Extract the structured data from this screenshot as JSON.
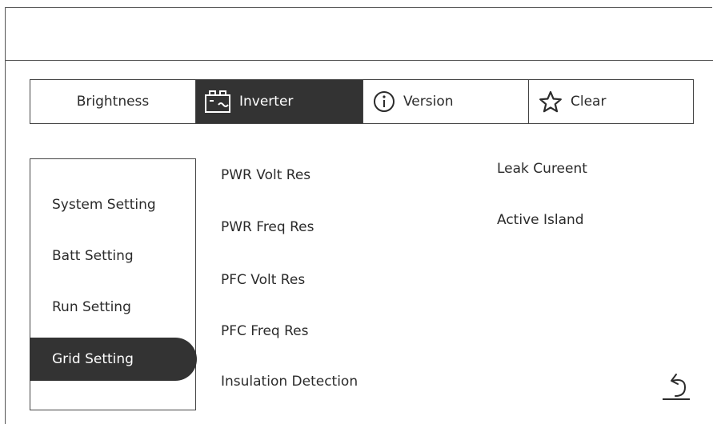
{
  "tabs": {
    "brightness": "Brightness",
    "inverter": "Inverter",
    "version": "Version",
    "clear": "Clear"
  },
  "sidebar": {
    "items": [
      {
        "label": "System Setting"
      },
      {
        "label": "Batt Setting"
      },
      {
        "label": "Run Setting"
      },
      {
        "label": "Grid Setting",
        "active": true
      }
    ]
  },
  "options": {
    "left": [
      "PWR Volt Res",
      "PWR Freq Res",
      "PFC Volt Res",
      "PFC Freq Res",
      "Insulation Detection"
    ],
    "right": [
      "Leak Cureent",
      "Active Island"
    ]
  },
  "icons": {
    "inverter": "battery-inverter-icon",
    "version": "info-icon",
    "clear": "star-icon",
    "back": "back-arrow-icon"
  },
  "colors": {
    "active_bg": "#333333",
    "text": "#2b2b2b",
    "border": "#444444"
  }
}
